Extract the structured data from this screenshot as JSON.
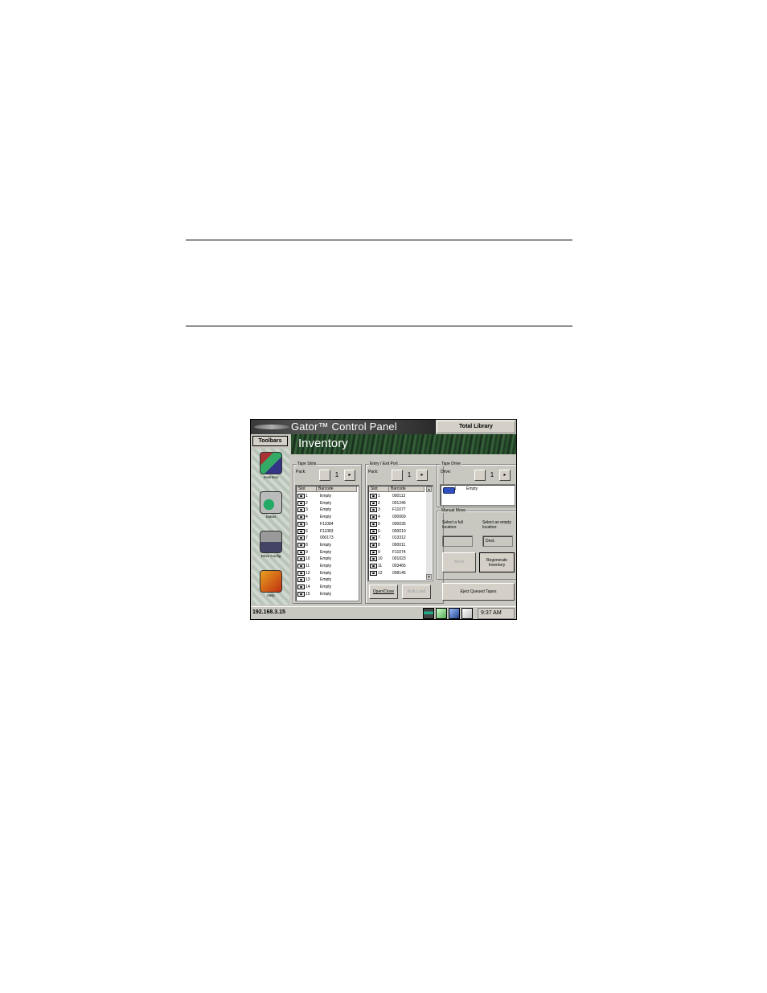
{
  "app": {
    "title": "Gator™ Control Panel",
    "total_library_label": "Total Library",
    "section_title": "Inventory",
    "toolbars_label": "Toolbars"
  },
  "toolbar": {
    "items": [
      {
        "label": "Inventory",
        "icon": "inventory-icon"
      },
      {
        "label": "Status",
        "icon": "status-icon"
      },
      {
        "label": "Drive Config",
        "icon": "drive-config-icon"
      },
      {
        "label": "Help",
        "icon": "help-icon"
      }
    ]
  },
  "tape_slots": {
    "title": "Tape Slots",
    "pack_label": "Pack:",
    "pack_value": "1",
    "columns": [
      "Slot",
      "Barcode"
    ],
    "rows": [
      {
        "slot": "1",
        "barcode": "Empty"
      },
      {
        "slot": "2",
        "barcode": "Empty"
      },
      {
        "slot": "3",
        "barcode": "Empty"
      },
      {
        "slot": "4",
        "barcode": "Empty"
      },
      {
        "slot": "5",
        "barcode": "F11084"
      },
      {
        "slot": "6",
        "barcode": "F11083"
      },
      {
        "slot": "7",
        "barcode": "000173"
      },
      {
        "slot": "8",
        "barcode": "Empty"
      },
      {
        "slot": "9",
        "barcode": "Empty"
      },
      {
        "slot": "10",
        "barcode": "Empty"
      },
      {
        "slot": "11",
        "barcode": "Empty"
      },
      {
        "slot": "12",
        "barcode": "Empty"
      },
      {
        "slot": "13",
        "barcode": "Empty"
      },
      {
        "slot": "14",
        "barcode": "Empty"
      },
      {
        "slot": "15",
        "barcode": "Empty"
      }
    ]
  },
  "entry_exit": {
    "title": "Entry / Exit Port",
    "pack_label": "Pack:",
    "pack_value": "1",
    "columns": [
      "Slot",
      "Barcode"
    ],
    "rows": [
      {
        "slot": "1",
        "barcode": "000112"
      },
      {
        "slot": "2",
        "barcode": "001246"
      },
      {
        "slot": "3",
        "barcode": "F11077"
      },
      {
        "slot": "4",
        "barcode": "000069"
      },
      {
        "slot": "5",
        "barcode": "000035"
      },
      {
        "slot": "6",
        "barcode": "000010"
      },
      {
        "slot": "7",
        "barcode": "013312"
      },
      {
        "slot": "8",
        "barcode": "000011"
      },
      {
        "slot": "9",
        "barcode": "F11074"
      },
      {
        "slot": "10",
        "barcode": "001023"
      },
      {
        "slot": "11",
        "barcode": "003465"
      },
      {
        "slot": "12",
        "barcode": "008145"
      }
    ],
    "open_close_label": "Open/Close",
    "bulk_load_label": "Bulk Load"
  },
  "tape_drive": {
    "title": "Tape Drive",
    "drive_label": "Drive:",
    "drive_value": "1",
    "drive_num": "1",
    "drive_status": "Empty"
  },
  "manual_move": {
    "title": "Manual Move",
    "full_location_label": "Select a full location:",
    "empty_location_label": "Select an empty location:",
    "dest_value": "Dest.",
    "move_label": "Move",
    "regenerate_label": "Regenerate Inventory",
    "eject_label": "Eject Queued Tapes"
  },
  "status_bar": {
    "ip": "192.168.3.15",
    "time": "9:37 AM"
  }
}
